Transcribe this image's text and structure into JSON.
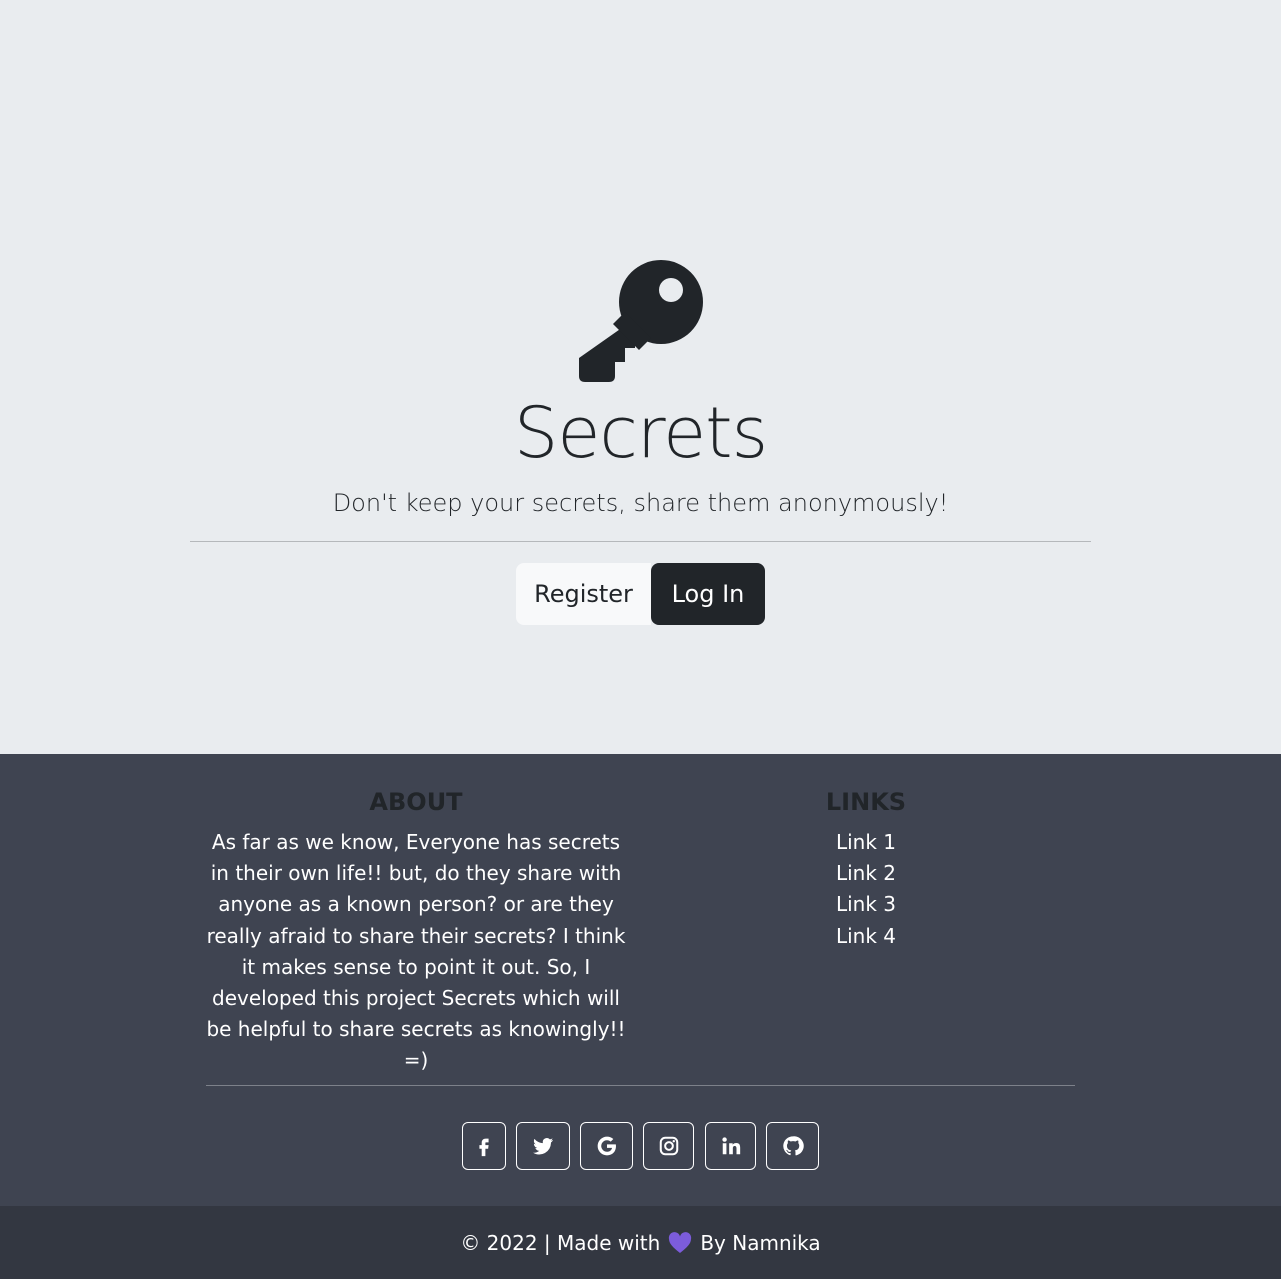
{
  "hero": {
    "title": "Secrets",
    "lead": "Don't keep your secrets, share them anonymously!",
    "register_label": "Register",
    "login_label": "Log In",
    "icon": "key-icon"
  },
  "footer": {
    "about_title": "ABOUT",
    "about_text": "As far as we know, Everyone has secrets in their own life!! but, do they share with anyone as a known person? or are they really afraid to share their secrets? I think it makes sense to point it out. So, I developed this project Secrets which will be helpful to share secrets as knowingly!! =)",
    "links_title": "LINKS",
    "links": [
      "Link 1",
      "Link 2",
      "Link 3",
      "Link 4"
    ],
    "social": [
      "facebook-icon",
      "twitter-icon",
      "google-icon",
      "instagram-icon",
      "linkedin-icon",
      "github-icon"
    ]
  },
  "copyright": {
    "prefix": "© 2022 | Made with",
    "suffix": "By Namnika",
    "heart_color": "#7c5cdb"
  },
  "colors": {
    "hero_bg": "#e9ecef",
    "footer_bg": "#3f4451",
    "copyright_bg": "#333741",
    "dark": "#212529"
  }
}
